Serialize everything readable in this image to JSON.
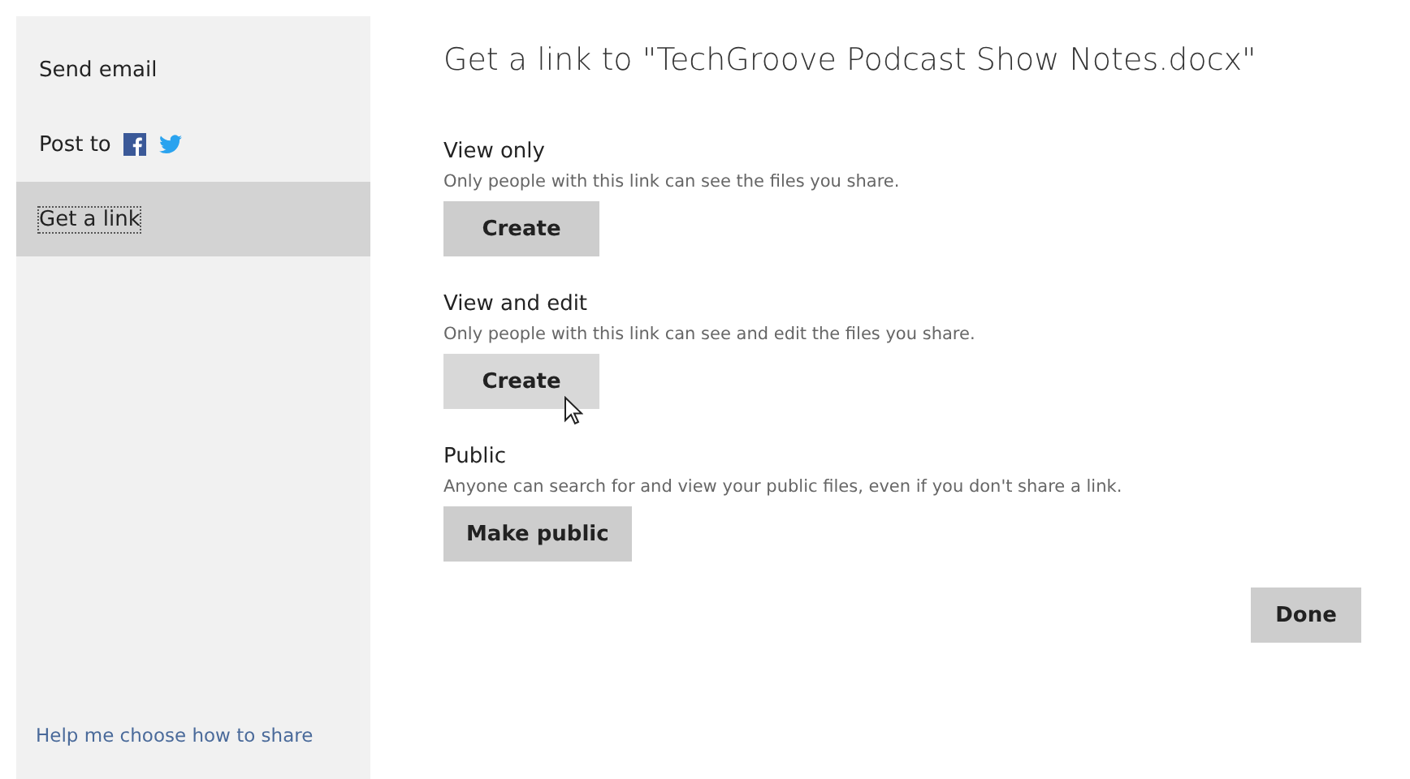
{
  "sidebar": {
    "items": [
      {
        "label": "Send email",
        "kind": "text",
        "selected": false
      },
      {
        "label": "Post to",
        "kind": "social",
        "selected": false
      },
      {
        "label": "Get a link",
        "kind": "text",
        "selected": true
      }
    ],
    "help_link": "Help me choose how to share"
  },
  "main": {
    "title": "Get a link to \"TechGroove Podcast Show Notes.docx\"",
    "sections": [
      {
        "heading": "View only",
        "description": "Only people with this link can see the files you share.",
        "button": "Create",
        "hovered": false
      },
      {
        "heading": "View and edit",
        "description": "Only people with this link can see and edit the files you share.",
        "button": "Create",
        "hovered": true
      },
      {
        "heading": "Public",
        "description": "Anyone can search for and view your public files, even if you don't share a link.",
        "button": "Make public",
        "hovered": false
      }
    ],
    "done_button": "Done"
  }
}
